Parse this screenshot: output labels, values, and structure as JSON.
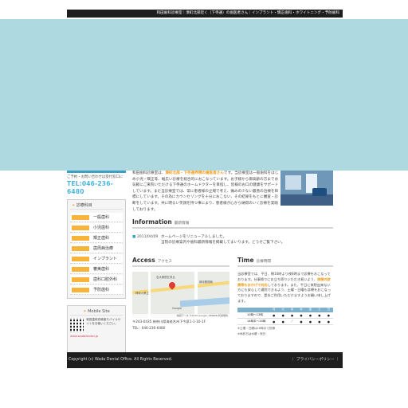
{
  "header": {
    "tagline": "和田歯科診療室｜湊町北部近く（下寺通）の歯医者さん｜インプラント・矯正歯科・ホワイトニング・予防歯科"
  },
  "contact": {
    "label": "ご予約・お問い合わせは受付窓口に",
    "tel": "TEL:046-236-6480"
  },
  "menu": {
    "title": "診療科目",
    "items": [
      {
        "label": "一般歯科"
      },
      {
        "label": "小児歯科"
      },
      {
        "label": "矯正歯科"
      },
      {
        "label": "歯周病治療"
      },
      {
        "label": "インプラント"
      },
      {
        "label": "審美歯科"
      },
      {
        "label": "歯科口腔外科"
      },
      {
        "label": "予防歯科"
      }
    ]
  },
  "mobile": {
    "title": "Mobile Site",
    "text": "和田歯科診療室モバイルサイトをお使いください。",
    "url": "www.wadadental.jp"
  },
  "intro": {
    "lead": "和田歯科診療室は、",
    "highlight": "湊町北部・下寺通界隈の歯医者さん",
    "rest": "です。当診療室は一般歯科をはじめ小児・矯正等、幅広い診療を総合的におこなっています。お子様から御高齢の方までお気軽にご来院いただける下寺通のホームドクターを目指し、皆様のお口の健康をサポートしています。また当診療室では、常に患者様の立場で考え、痛みの少ない最善の治療を目標にしています。その為にカウンセリングを十分におこない、その結果をもとに審査・診断をしています。共に明るい笑顔を持つ事により、患者様が心から納得のいく診療を実践しております。"
  },
  "info": {
    "title": "Information",
    "subtitle": "最新情報",
    "items": [
      {
        "date": "2011/04/09",
        "lines": [
          "ホームページをリニューアルしました。",
          "当院の診療案内や歯科最新情報を掲載してまいります。どうぞご覧下さい。"
        ]
      }
    ]
  },
  "access": {
    "title": "Access",
    "subtitle": "アクセス",
    "map_labels": [
      "名大病院を見る",
      "神奈川県立",
      "緑寺郵便局",
      "Google"
    ],
    "map_footer": "地図データ ©2015 Google, ZENRIN 利用規約",
    "address": "〒243-0435 神奈川県海老名市下今泉1-1-10-1F",
    "tel": "TEL：046-236-6480"
  },
  "time": {
    "title": "Time",
    "subtitle": "診療時間",
    "lead": "当診療室では、平日、朝10時より夜8時まで診療をおこなっております。仕事帰りにお立ち寄りいただき易いよう、",
    "highlight": "夜間の診療等もおかげで対応",
    "rest": "しております。また、平日に来院出来ない方にも安心して通院できるよう、土曜・日曜も診療をおこなっておりますので、是非ご利用いただけますようお願い申し上げます。",
    "table": {
      "headers": [
        "",
        "月",
        "火",
        "水",
        "木",
        "金",
        "土",
        "日"
      ],
      "rows": [
        {
          "label": "10時〜13時",
          "cells": [
            "●",
            "●",
            "●",
            "●",
            "●",
            "●",
            "●"
          ]
        },
        {
          "label": "14時半〜20時",
          "cells": [
            "●",
            "●",
            "／",
            "●",
            "●",
            "●",
            "●"
          ]
        }
      ]
    },
    "notes": [
      "※土曜・日曜は18時まで診療",
      "※休診日は水曜・祝日"
    ]
  },
  "footer": {
    "copyright": "Copyright (c) Wada Dental Office. All Rights Reserved.",
    "privacy": "｜ プライバシーポリシー ｜"
  },
  "colors": {
    "hero": "#aed9e0",
    "accent": "#f7b43a",
    "blue": "#49b4dd",
    "dark": "#1e1e1e"
  }
}
